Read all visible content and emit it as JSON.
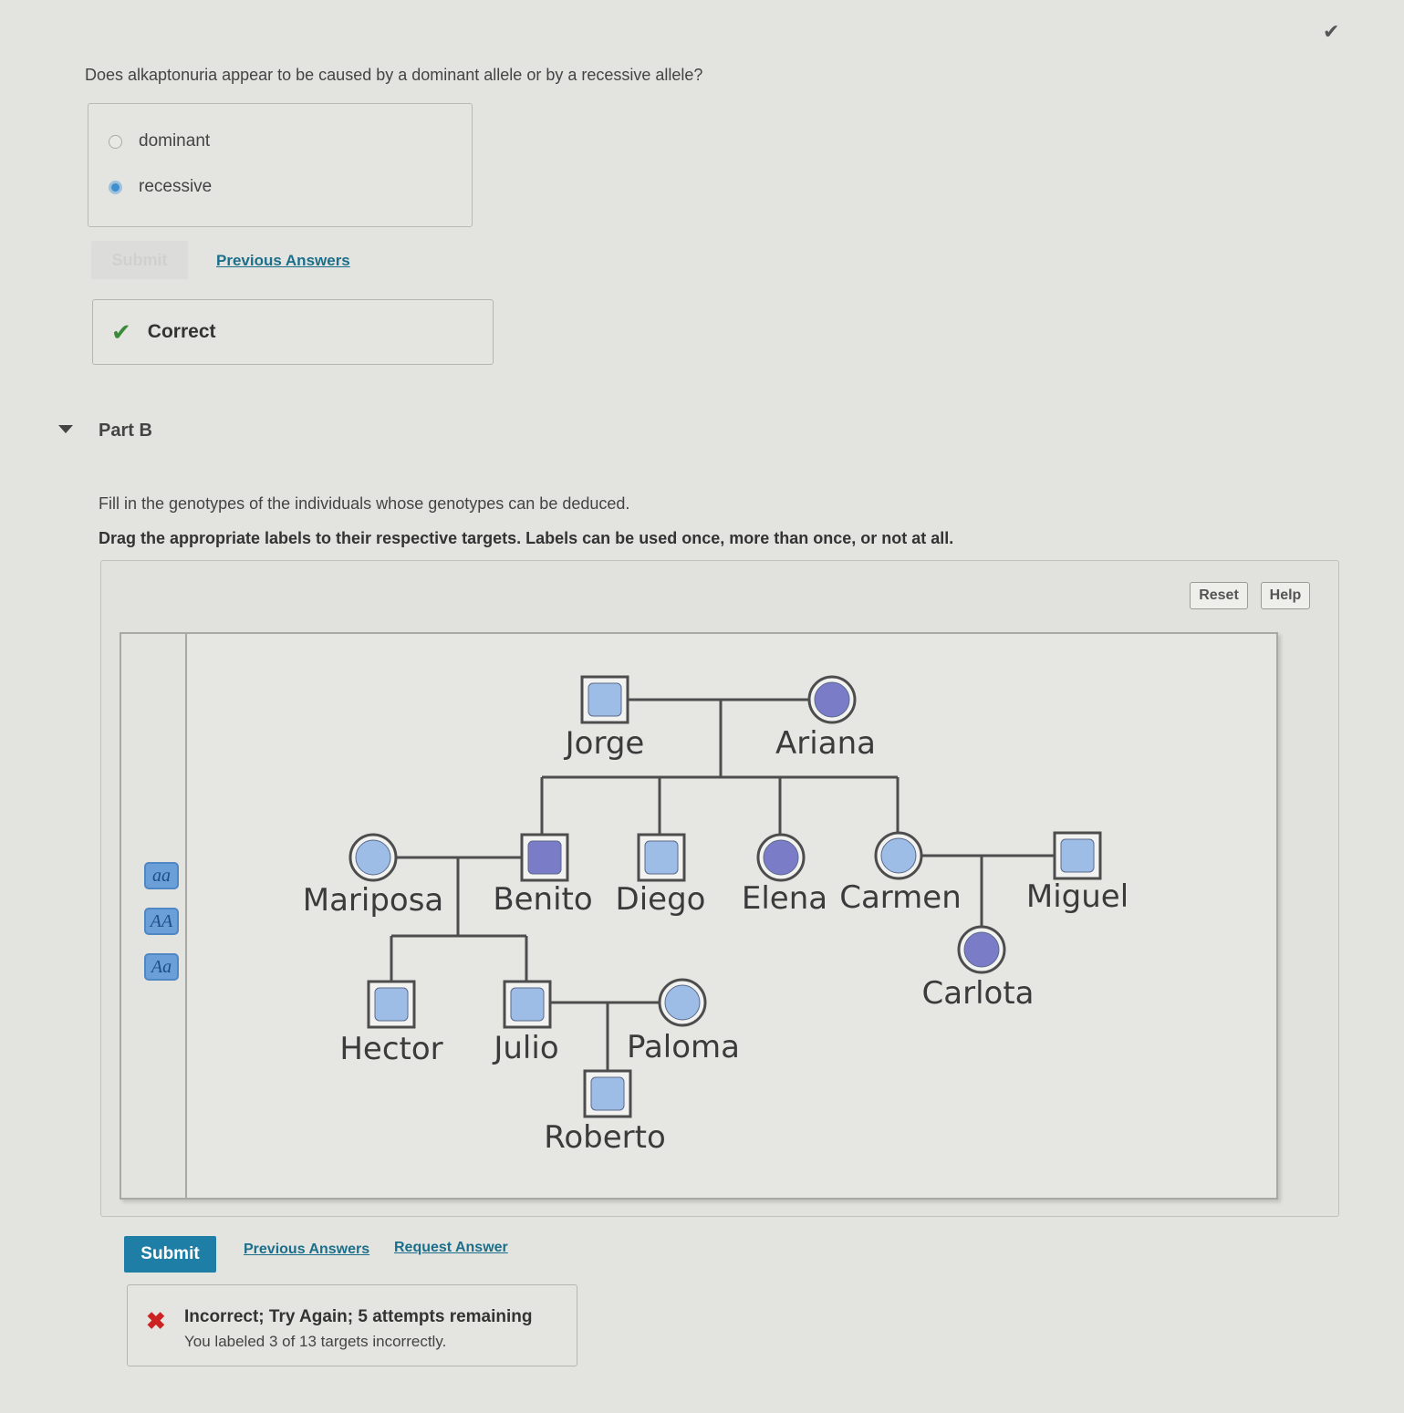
{
  "top": {
    "check_icon": "check-icon"
  },
  "part_a": {
    "question": "Does alkaptonuria appear to be caused by a dominant allele or by a recessive allele?",
    "options": [
      {
        "label": "dominant",
        "selected": false
      },
      {
        "label": "recessive",
        "selected": true
      }
    ],
    "submit_label": "Submit",
    "previous_answers_label": "Previous Answers",
    "feedback": "Correct"
  },
  "part_b": {
    "title": "Part B",
    "instruction": "Fill in the genotypes of the individuals whose genotypes can be deduced.",
    "instruction_bold": "Drag the appropriate labels to their respective targets. Labels can be used once, more than once, or not at all.",
    "reset_label": "Reset",
    "help_label": "Help",
    "labels": [
      "aa",
      "AA",
      "Aa"
    ],
    "pedigree": {
      "individuals": [
        {
          "name": "Jorge",
          "sex": "male",
          "affected": false
        },
        {
          "name": "Ariana",
          "sex": "female",
          "affected": true
        },
        {
          "name": "Mariposa",
          "sex": "female",
          "affected": false
        },
        {
          "name": "Benito",
          "sex": "male",
          "affected": true
        },
        {
          "name": "Diego",
          "sex": "male",
          "affected": false
        },
        {
          "name": "Elena",
          "sex": "female",
          "affected": true
        },
        {
          "name": "Carmen",
          "sex": "female",
          "affected": false
        },
        {
          "name": "Miguel",
          "sex": "male",
          "affected": false
        },
        {
          "name": "Carlota",
          "sex": "female",
          "affected": true
        },
        {
          "name": "Hector",
          "sex": "male",
          "affected": false
        },
        {
          "name": "Julio",
          "sex": "male",
          "affected": false
        },
        {
          "name": "Paloma",
          "sex": "female",
          "affected": false
        },
        {
          "name": "Roberto",
          "sex": "male",
          "affected": false
        }
      ],
      "colors": {
        "unaffected": "#9dbde6",
        "affected": "#7a7cc8",
        "outline": "#4d4d4d"
      }
    },
    "submit_label": "Submit",
    "previous_answers_label": "Previous Answers",
    "request_answer_label": "Request Answer",
    "feedback_title": "Incorrect; Try Again; 5 attempts remaining",
    "feedback_detail": "You labeled 3 of 13 targets incorrectly."
  }
}
